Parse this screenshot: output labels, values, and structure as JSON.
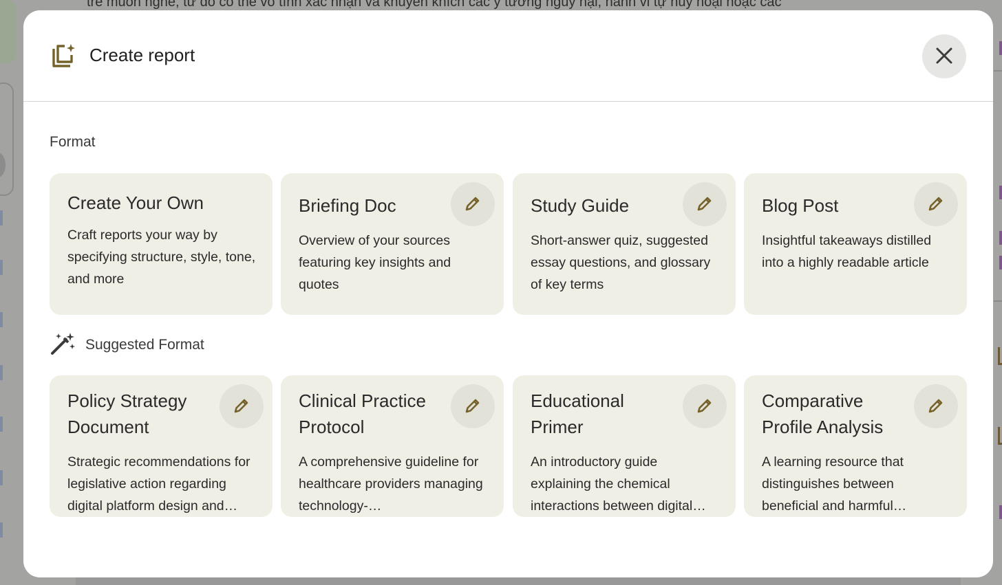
{
  "background": {
    "text": "trẻ muốn nghe, từ đó có thể vô tình xác nhận và khuyến khích các ý tưởng nguy hại, hành vi tự hủy hoại hoặc các"
  },
  "dialog": {
    "title": "Create report",
    "header_icon": "report-stack-sparkle-icon",
    "close_icon": "close-icon"
  },
  "format_section": {
    "label": "Format",
    "cards": [
      {
        "title": "Create Your Own",
        "description": "Craft reports your way by specifying structure, style, tone, and more",
        "editable": false
      },
      {
        "title": "Briefing Doc",
        "description": "Overview of your sources featuring key insights and quotes",
        "editable": true
      },
      {
        "title": "Study Guide",
        "description": "Short-answer quiz, suggested essay questions, and glossary of key terms",
        "editable": true
      },
      {
        "title": "Blog Post",
        "description": "Insightful takeaways distilled into a highly readable article",
        "editable": true
      }
    ]
  },
  "suggested_section": {
    "label": "Suggested Format",
    "icon": "magic-wand-icon",
    "cards": [
      {
        "title": "Policy Strategy Document",
        "description": "Strategic recommendations for legislative action regarding digital platform design and…",
        "editable": true
      },
      {
        "title": "Clinical Practice Protocol",
        "description": "A comprehensive guideline for healthcare providers managing technology-…",
        "editable": true
      },
      {
        "title": "Educational Primer",
        "description": "An introductory guide explaining the chemical interactions between digital…",
        "editable": true
      },
      {
        "title": "Comparative Profile Analysis",
        "description": "A learning resource that distinguishes between beneficial and harmful…",
        "editable": true
      }
    ]
  },
  "colors": {
    "accent": "#75622a",
    "card_background": "#f0efe5",
    "edit_button_background": "#e3e2d9"
  }
}
